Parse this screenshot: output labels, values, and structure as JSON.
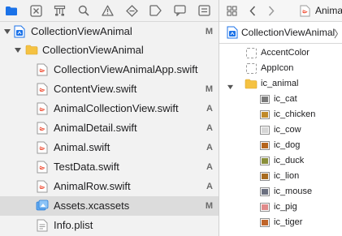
{
  "navigator": {
    "toolbar": {
      "icons": [
        "folder-icon",
        "xmark-box-icon",
        "hierarchy-icon",
        "search-icon",
        "warning-icon",
        "diamond-icon",
        "tag-icon",
        "comment-icon"
      ],
      "accent": "#1b72e8"
    },
    "tree": [
      {
        "label": "CollectionViewAnimal",
        "badge": "M",
        "icon": "project-icon",
        "expanded": true,
        "selected": false
      },
      {
        "label": "CollectionViewAnimal",
        "badge": "",
        "icon": "folder-icon",
        "expanded": true,
        "selected": false
      },
      {
        "label": "CollectionViewAnimalApp.swift",
        "badge": "",
        "icon": "swift-file-icon",
        "selected": false
      },
      {
        "label": "ContentView.swift",
        "badge": "M",
        "icon": "swift-file-icon",
        "selected": false
      },
      {
        "label": "AnimalCollectionView.swift",
        "badge": "A",
        "icon": "swift-file-icon",
        "selected": false
      },
      {
        "label": "AnimalDetail.swift",
        "badge": "A",
        "icon": "swift-file-icon",
        "selected": false
      },
      {
        "label": "Animal.swift",
        "badge": "A",
        "icon": "swift-file-icon",
        "selected": false
      },
      {
        "label": "TestData.swift",
        "badge": "A",
        "icon": "swift-file-icon",
        "selected": false
      },
      {
        "label": "AnimalRow.swift",
        "badge": "A",
        "icon": "swift-file-icon",
        "selected": false
      },
      {
        "label": "Assets.xcassets",
        "badge": "M",
        "icon": "asset-catalog-icon",
        "selected": true
      },
      {
        "label": "Info.plist",
        "badge": "",
        "icon": "plist-file-icon",
        "selected": false
      }
    ]
  },
  "editor": {
    "tab": {
      "label": "Anima"
    },
    "jumpbar": {
      "label": "CollectionViewAnimal",
      "chevron": "〉"
    },
    "assets": [
      {
        "label": "AccentColor",
        "kind": "color"
      },
      {
        "label": "AppIcon",
        "kind": "appicon"
      },
      {
        "label": "ic_animal",
        "kind": "folder",
        "expanded": true
      },
      {
        "label": "ic_cat",
        "kind": "image",
        "color": "#7a7a7a"
      },
      {
        "label": "ic_chicken",
        "kind": "image",
        "color": "#c08a2a"
      },
      {
        "label": "ic_cow",
        "kind": "image",
        "color": "#d6d6d6"
      },
      {
        "label": "ic_dog",
        "kind": "image",
        "color": "#b5651d"
      },
      {
        "label": "ic_duck",
        "kind": "image",
        "color": "#8a8f3a"
      },
      {
        "label": "ic_lion",
        "kind": "image",
        "color": "#a86b1f"
      },
      {
        "label": "ic_mouse",
        "kind": "image",
        "color": "#6b7080"
      },
      {
        "label": "ic_pig",
        "kind": "image",
        "color": "#e08a8a"
      },
      {
        "label": "ic_tiger",
        "kind": "image",
        "color": "#c0652a"
      }
    ]
  }
}
